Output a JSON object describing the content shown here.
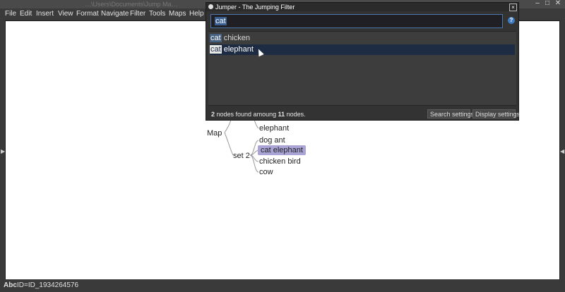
{
  "window": {
    "title": "…\\Users\\Documents\\Jump Ma…"
  },
  "menu": {
    "items": [
      "File",
      "Edit",
      "Insert",
      "View",
      "Format",
      "Navigate",
      "Filter",
      "Tools",
      "Maps",
      "Help"
    ]
  },
  "mindmap": {
    "root": "Map",
    "set2_label": "set 2",
    "elephant_node": "elephant",
    "children_set2": [
      "dog ant",
      "cat elephant",
      "chicken bird",
      "cow"
    ]
  },
  "status": {
    "abc": "Abc",
    "id": "ID=ID_1934264576"
  },
  "dialog": {
    "title": "Jumper - The Jumping Filter",
    "close_label": "×",
    "search": {
      "value": "cat"
    },
    "help_label": "?",
    "results": [
      {
        "match": "cat",
        "rest": " chicken"
      },
      {
        "match": "cat",
        "rest": " elephant"
      }
    ],
    "found_count": "2",
    "found_text_mid": " nodes found amoung ",
    "total_nodes": "11",
    "found_text_end": " nodes.",
    "buttons": {
      "search_settings": "Search settings",
      "display_settings": "Display settings"
    }
  },
  "colors": {
    "selected_node_bg": "#a9a3d6",
    "search_border": "#4b77ad",
    "selected_row": "#1d2c42"
  }
}
